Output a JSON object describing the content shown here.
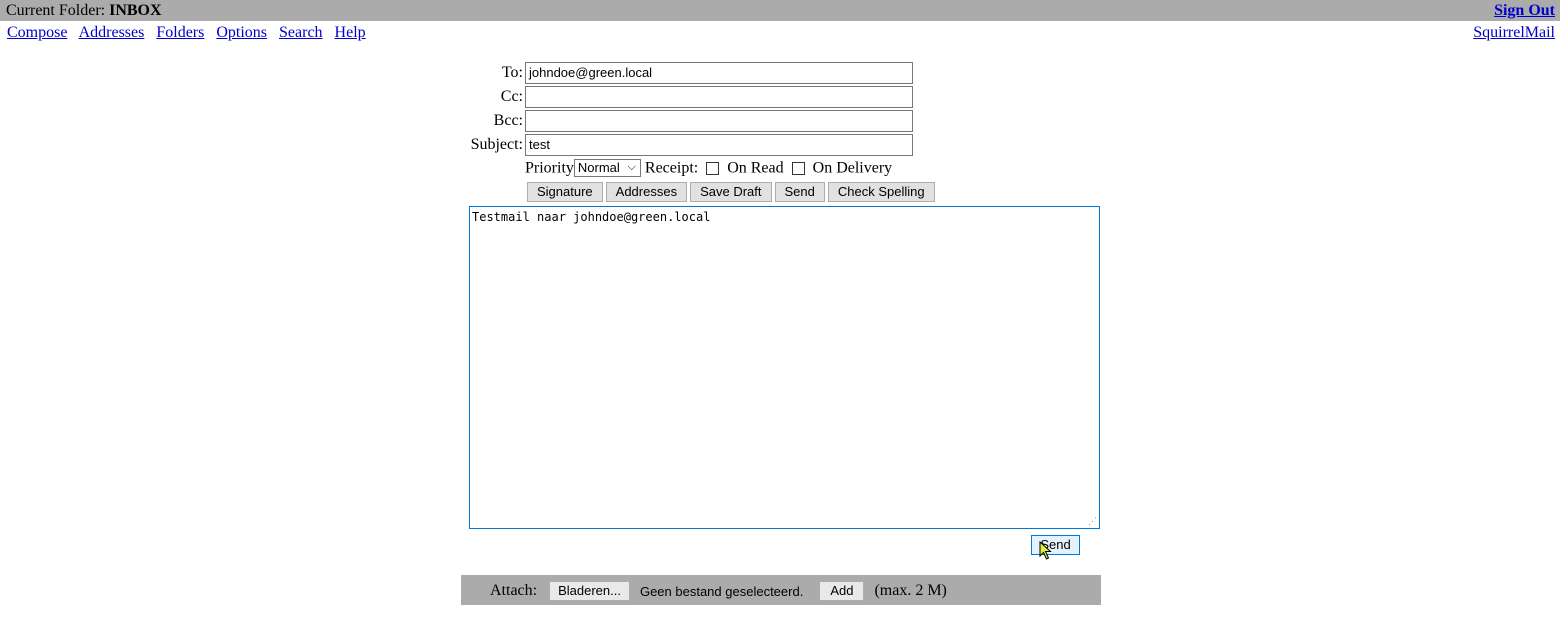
{
  "header": {
    "folder_prefix": "Current Folder: ",
    "folder_name": "INBOX",
    "sign_out": "Sign Out"
  },
  "nav": {
    "items": [
      "Compose",
      "Addresses",
      "Folders",
      "Options",
      "Search",
      "Help"
    ],
    "brand": "SquirrelMail"
  },
  "compose": {
    "to_label": "To:",
    "to_value": "johndoe@green.local",
    "cc_label": "Cc:",
    "cc_value": "",
    "bcc_label": "Bcc:",
    "bcc_value": "",
    "subject_label": "Subject:",
    "subject_value": "test",
    "priority_label": "Priority",
    "priority_value": "Normal",
    "receipt_label": "Receipt:",
    "on_read_label": "On Read",
    "on_delivery_label": "On Delivery",
    "buttons": [
      "Signature",
      "Addresses",
      "Save Draft",
      "Send",
      "Check Spelling"
    ],
    "body_text": "Testmail naar johndoe@green.local",
    "send_label": "Send"
  },
  "attach": {
    "label": "Attach:",
    "browse_label": "Bladeren...",
    "no_file_text": "Geen bestand geselecteerd.",
    "add_label": "Add",
    "max_text": "(max. 2 M)"
  },
  "colors": {
    "bar_bg": "#ababab",
    "link": "#0000cc",
    "focus": "#0078d7"
  }
}
